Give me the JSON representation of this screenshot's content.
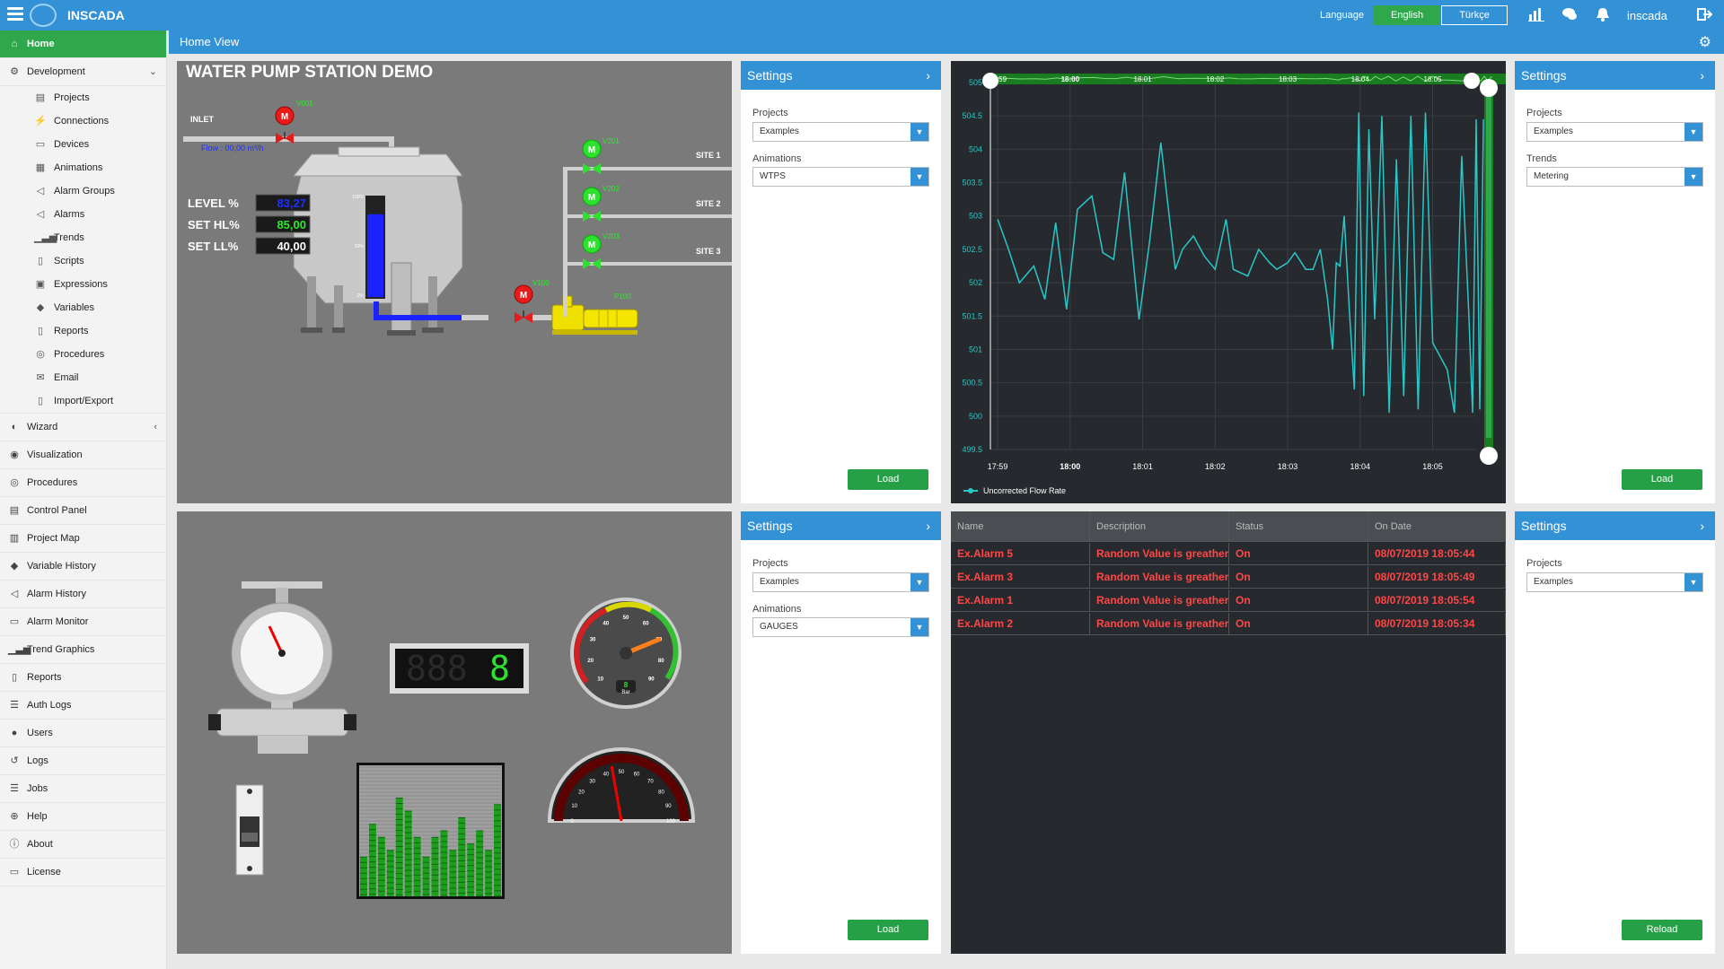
{
  "app": {
    "brand": "INSCADA",
    "user": "inscada"
  },
  "language": {
    "label": "Language",
    "options": [
      "English",
      "Türkçe"
    ],
    "selected": "English"
  },
  "breadcrumb": {
    "title": "Home View"
  },
  "sidebar": {
    "items": [
      {
        "label": "Home",
        "icon": "home-icon",
        "active": true
      },
      {
        "label": "Development",
        "icon": "gear-icon",
        "expanded": true,
        "children": [
          {
            "label": "Projects",
            "icon": "briefcase-icon"
          },
          {
            "label": "Connections",
            "icon": "plug-icon"
          },
          {
            "label": "Devices",
            "icon": "monitor-icon"
          },
          {
            "label": "Animations",
            "icon": "film-icon"
          },
          {
            "label": "Alarm Groups",
            "icon": "bullhorn-icon"
          },
          {
            "label": "Alarms",
            "icon": "bullhorn-icon"
          },
          {
            "label": "Trends",
            "icon": "bar-signal-icon"
          },
          {
            "label": "Scripts",
            "icon": "document-icon"
          },
          {
            "label": "Expressions",
            "icon": "calculator-icon"
          },
          {
            "label": "Variables",
            "icon": "tags-icon"
          },
          {
            "label": "Reports",
            "icon": "document-icon"
          },
          {
            "label": "Procedures",
            "icon": "target-icon"
          },
          {
            "label": "Email",
            "icon": "envelope-icon"
          },
          {
            "label": "Import/Export",
            "icon": "document-icon"
          }
        ]
      },
      {
        "label": "Wizard",
        "icon": "wizard-icon",
        "chevron": "left"
      },
      {
        "label": "Visualization",
        "icon": "eye-icon"
      },
      {
        "label": "Procedures",
        "icon": "target-icon"
      },
      {
        "label": "Control Panel",
        "icon": "panel-icon"
      },
      {
        "label": "Project Map",
        "icon": "map-icon"
      },
      {
        "label": "Variable History",
        "icon": "tag-icon"
      },
      {
        "label": "Alarm History",
        "icon": "bullhorn-icon"
      },
      {
        "label": "Alarm Monitor",
        "icon": "monitor-icon"
      },
      {
        "label": "Trend Graphics",
        "icon": "bar-signal-icon"
      },
      {
        "label": "Reports",
        "icon": "document-icon"
      },
      {
        "label": "Auth Logs",
        "icon": "list-icon"
      },
      {
        "label": "Users",
        "icon": "user-icon"
      },
      {
        "label": "Logs",
        "icon": "history-icon"
      },
      {
        "label": "Jobs",
        "icon": "list-icon"
      },
      {
        "label": "Help",
        "icon": "lifebuoy-icon"
      },
      {
        "label": "About",
        "icon": "info-icon"
      },
      {
        "label": "License",
        "icon": "id-card-icon"
      }
    ]
  },
  "panels": {
    "settings_1": {
      "title": "Settings",
      "projects_label": "Projects",
      "projects_value": "Examples",
      "second_label": "Animations",
      "second_value": "WTPS",
      "button": "Load"
    },
    "settings_2": {
      "title": "Settings",
      "projects_label": "Projects",
      "projects_value": "Examples",
      "second_label": "Trends",
      "second_value": "Metering",
      "button": "Load"
    },
    "settings_3": {
      "title": "Settings",
      "projects_label": "Projects",
      "projects_value": "Examples",
      "second_label": "Animations",
      "second_value": "GAUGES",
      "button": "Load"
    },
    "settings_4": {
      "title": "Settings",
      "projects_label": "Projects",
      "projects_value": "Examples",
      "button": "Reload"
    }
  },
  "pump_station": {
    "title": "WATER PUMP STATION DEMO",
    "inlet": "INLET",
    "flow": "Flow : 00,00 m³/h",
    "valves": [
      "V001",
      "V201",
      "V202",
      "V203",
      "V100"
    ],
    "pump": "P100",
    "sites": [
      "SITE 1",
      "SITE 2",
      "SITE 3"
    ],
    "level_label": "LEVEL %",
    "level_value": "83,27",
    "set_hl_label": "SET HL%",
    "set_hl_value": "85,00",
    "set_ll_label": "SET LL%",
    "set_ll_value": "40,00",
    "tank_scale": [
      "100%",
      "50%",
      "0%"
    ],
    "tank_level": 0.83
  },
  "gauges": {
    "digital_display": "8",
    "gauge1_unit": "Bar",
    "gauge1_value": "8",
    "gauge1_ticks": [
      "10",
      "20",
      "30",
      "40",
      "50",
      "60",
      "70",
      "80",
      "90"
    ],
    "gauge2_ticks": [
      "0",
      "10",
      "20",
      "30",
      "40",
      "50",
      "60",
      "70",
      "80",
      "90",
      "100"
    ],
    "gauge2_value": 50,
    "gauge1_needle_value": 70,
    "bar_levels": [
      0.3,
      0.55,
      0.45,
      0.35,
      0.75,
      0.65,
      0.45,
      0.3,
      0.45,
      0.5,
      0.35,
      0.6,
      0.4,
      0.5,
      0.35,
      0.7
    ]
  },
  "chart_data": {
    "type": "line",
    "title": "",
    "xlabel": "",
    "ylabel": "",
    "x_ticks": [
      "17:59",
      "18:00",
      "18:01",
      "18:02",
      "18:03",
      "18:04",
      "18:05"
    ],
    "y_ticks": [
      "499.5",
      "500",
      "500.5",
      "501",
      "501.5",
      "502",
      "502.5",
      "503",
      "503.5",
      "504",
      "504.5",
      "505"
    ],
    "ylim": [
      499.5,
      505
    ],
    "xlim_minutes": [
      -0.1,
      6.6
    ],
    "legend": "bottom-left",
    "series": [
      {
        "name": "Uncorrected Flow Rate",
        "color": "#29c7c7",
        "x": [
          0.0,
          0.15,
          0.3,
          0.5,
          0.65,
          0.8,
          0.95,
          1.1,
          1.3,
          1.45,
          1.6,
          1.75,
          1.95,
          2.1,
          2.25,
          2.45,
          2.55,
          2.7,
          2.85,
          3.0,
          3.15,
          3.25,
          3.45,
          3.6,
          3.75,
          3.85,
          4.0,
          4.1,
          4.25,
          4.35,
          4.45,
          4.55,
          4.62,
          4.67,
          4.72,
          4.78,
          4.85,
          4.92,
          4.98,
          5.05,
          5.12,
          5.2,
          5.3,
          5.4,
          5.5,
          5.6,
          5.7,
          5.8,
          5.9,
          6.0,
          6.1,
          6.2,
          6.3,
          6.4,
          6.5,
          6.55,
          6.6,
          6.65,
          6.7
        ],
        "y": [
          502.95,
          502.5,
          502.0,
          502.25,
          501.75,
          502.9,
          501.6,
          503.1,
          503.3,
          502.45,
          502.35,
          503.65,
          501.45,
          502.65,
          504.1,
          502.2,
          502.5,
          502.7,
          502.4,
          502.2,
          502.95,
          502.2,
          502.1,
          502.5,
          502.3,
          502.2,
          502.3,
          502.45,
          502.2,
          502.2,
          502.5,
          501.75,
          501.0,
          502.3,
          502.25,
          503.0,
          501.6,
          500.4,
          504.55,
          500.3,
          504.3,
          501.45,
          504.5,
          500.05,
          503.85,
          500.3,
          504.5,
          500.1,
          504.55,
          501.1,
          500.9,
          500.7,
          500.05,
          503.9,
          501.5,
          500.05,
          504.45,
          500.1,
          504.45
        ]
      }
    ]
  },
  "alarm_table": {
    "headers": [
      "Name",
      "Description",
      "Status",
      "On Date"
    ],
    "rows": [
      [
        "Ex.Alarm 5",
        "Random Value is greather than",
        "On",
        "08/07/2019 18:05:44"
      ],
      [
        "Ex.Alarm 3",
        "Random Value is greather than",
        "On",
        "08/07/2019 18:05:49"
      ],
      [
        "Ex.Alarm 1",
        "Random Value is greather than",
        "On",
        "08/07/2019 18:05:54"
      ],
      [
        "Ex.Alarm 2",
        "Random Value is greather than",
        "On",
        "08/07/2019 18:05:34"
      ]
    ]
  },
  "colors": {
    "primary": "#3391d5",
    "success": "#26a047",
    "alarm": "#ff4747",
    "trend": "#29c7c7"
  }
}
